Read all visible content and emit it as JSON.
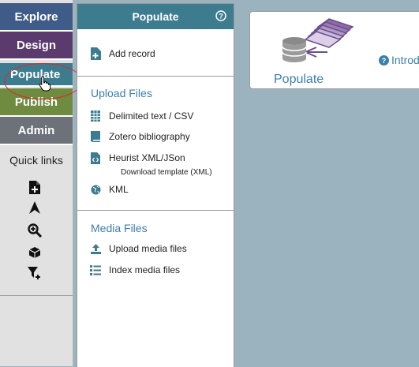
{
  "nav": {
    "explore": "Explore",
    "design": "Design",
    "populate": "Populate",
    "publish": "Publish",
    "admin": "Admin",
    "colors": {
      "explore": "#3f5b87",
      "design": "#5b3a6e",
      "populate": "#3d7c8f",
      "publish": "#6e8b3f",
      "admin": "#6d7179"
    }
  },
  "quick_links": {
    "label": "Quick links",
    "icons": [
      "add-file-icon",
      "navigate-arrow-icon",
      "zoom-in-icon",
      "cube-icon",
      "filter-add-icon"
    ]
  },
  "panel": {
    "title": "Populate",
    "add_record": "Add record",
    "upload_files_title": "Upload Files",
    "upload_items": {
      "delimited": "Delimited text / CSV",
      "zotero": "Zotero bibliography",
      "heurist_xml": "Heurist XML/JSon",
      "download_template": "Download template (XML)",
      "kml": "KML"
    },
    "media_files_title": "Media Files",
    "media_items": {
      "upload_media": "Upload media files",
      "index_media": "Index media files"
    }
  },
  "content": {
    "card_title": "Populate",
    "intro_link": "Introduction"
  },
  "colors": {
    "accent": "#3d7c8f",
    "link": "#3a7fae",
    "background": "#9bb3bf",
    "highlight": "#e0252a"
  }
}
